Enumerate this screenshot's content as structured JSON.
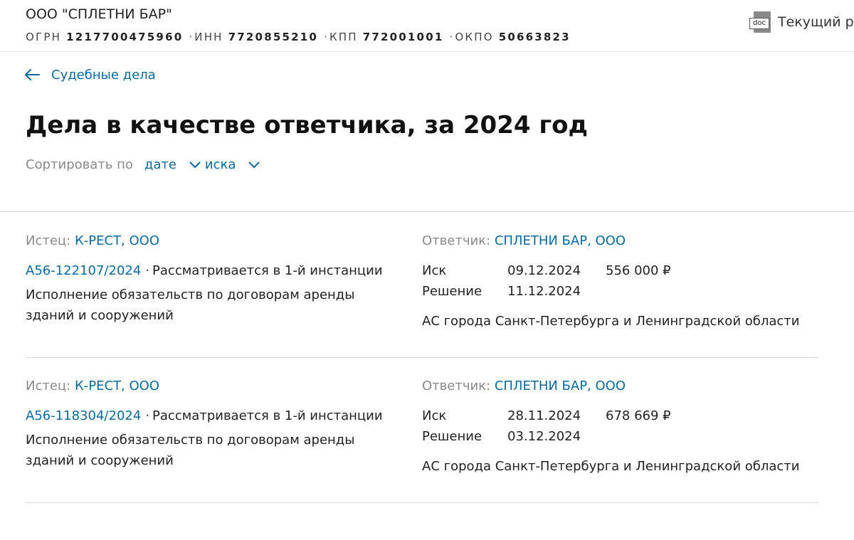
{
  "header": {
    "company": "ООО \"СПЛЕТНИ БАР\"",
    "ogrn_label": "ОГРН",
    "ogrn": "1217700475960",
    "inn_label": "ИНН",
    "inn": "7720855210",
    "kpp_label": "КПП",
    "kpp": "772001001",
    "okpo_label": "ОКПО",
    "okpo": "50663823",
    "doc_icon_text": "doc",
    "doc_link": "Текущий р"
  },
  "nav": {
    "back_label": "Судебные дела"
  },
  "page": {
    "title": "Дела в качестве ответчика, за 2024 год"
  },
  "sort": {
    "label": "Сортировать по",
    "options": [
      "дате",
      "иска"
    ]
  },
  "cases": [
    {
      "plaintiff_label": "Истец:",
      "plaintiff": "К-РЕСТ, ООО",
      "number": "А56-122107/2024",
      "status": "Рассматривается в 1-й инстанции",
      "description": "Исполнение обязательств по договорам аренды зданий и сооружений",
      "defendant_label": "Ответчик:",
      "defendant": "СПЛЕТНИ БАР, ООО",
      "claim_label": "Иск",
      "claim_date": "09.12.2024",
      "claim_sum": "556 000 ₽",
      "decision_label": "Решение",
      "decision_date": "11.12.2024",
      "court": "АС города Санкт-Петербурга и Ленинградской области"
    },
    {
      "plaintiff_label": "Истец:",
      "plaintiff": "К-РЕСТ, ООО",
      "number": "А56-118304/2024",
      "status": "Рассматривается в 1-й инстанции",
      "description": "Исполнение обязательств по договорам аренды зданий и сооружений",
      "defendant_label": "Ответчик:",
      "defendant": "СПЛЕТНИ БАР, ООО",
      "claim_label": "Иск",
      "claim_date": "28.11.2024",
      "claim_sum": "678 669 ₽",
      "decision_label": "Решение",
      "decision_date": "03.12.2024",
      "court": "АС города Санкт-Петербурга и Ленинградской области"
    }
  ],
  "colors": {
    "link": "#0a6a9e",
    "muted": "#8a8a8a",
    "divider": "#d8d8d8"
  }
}
